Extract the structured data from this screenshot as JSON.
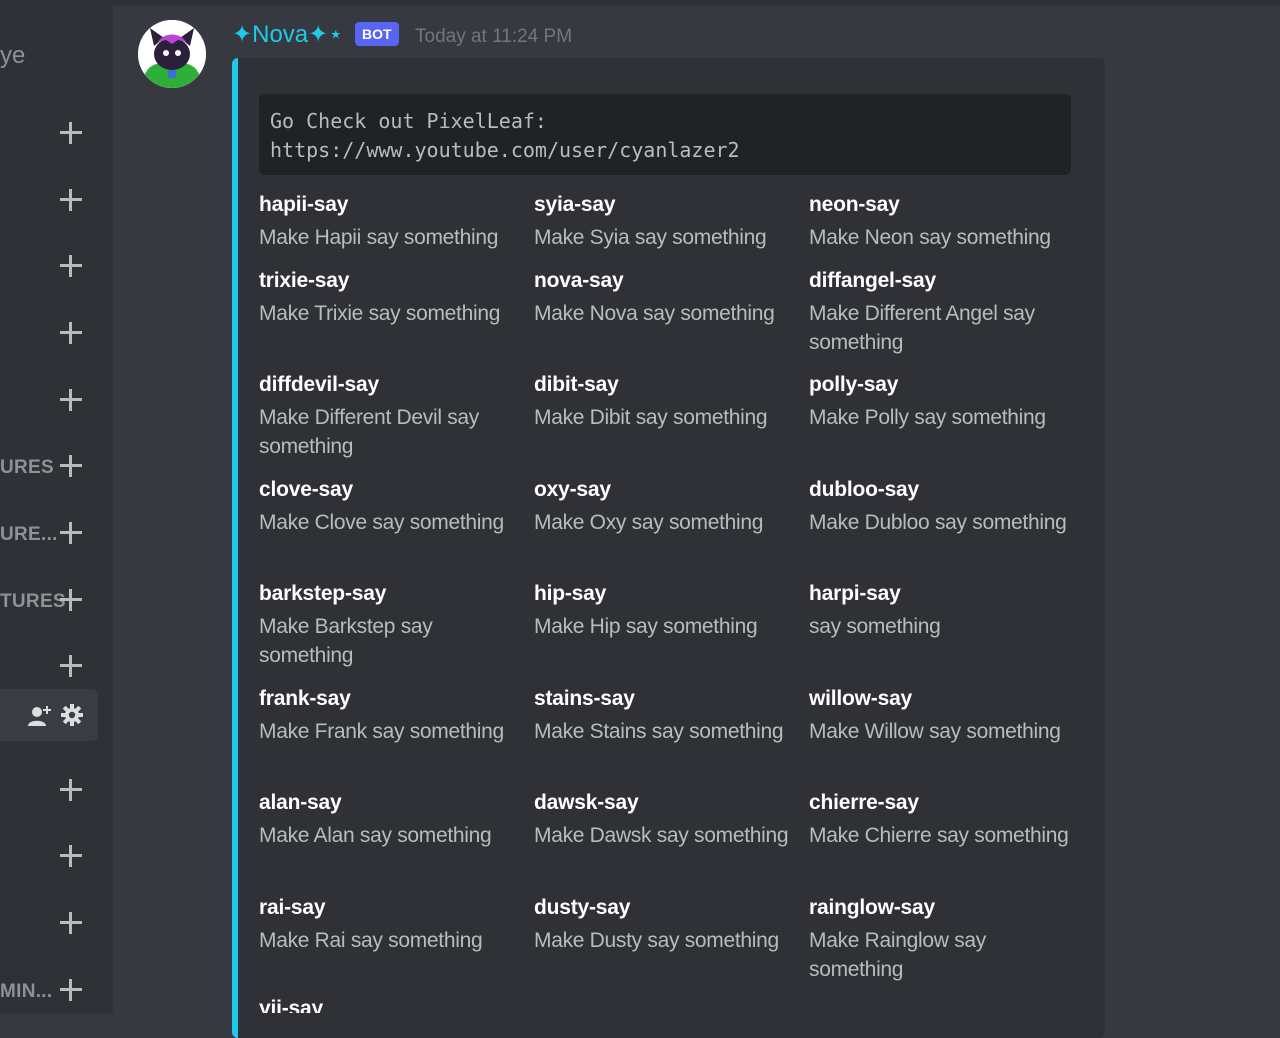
{
  "sidebar": {
    "top_label": "ye",
    "rows": [
      {
        "label": ""
      },
      {
        "label": ""
      },
      {
        "label": ""
      },
      {
        "label": ""
      },
      {
        "label": ""
      },
      {
        "label": "URES"
      },
      {
        "label": "URE..."
      },
      {
        "label": "TURES"
      },
      {
        "label": ""
      },
      {
        "label": ""
      },
      {
        "label": ""
      },
      {
        "label": ""
      },
      {
        "label": "MIN..."
      }
    ]
  },
  "message": {
    "username": "✦Nova✦⋆",
    "bot_tag": "BOT",
    "timestamp": "Today at 11:24 PM",
    "code_lines": [
      "Go Check out PixelLeaf:",
      "https://www.youtube.com/user/cyanlazer2"
    ],
    "fields": [
      {
        "name": "hapii-say",
        "value": "Make Hapii say something"
      },
      {
        "name": "syia-say",
        "value": "Make Syia say something"
      },
      {
        "name": "neon-say",
        "value": "Make Neon say something"
      },
      {
        "name": "trixie-say",
        "value": "Make Trixie say something"
      },
      {
        "name": "nova-say",
        "value": "Make Nova say something"
      },
      {
        "name": "diffangel-say",
        "value": "Make Different Angel say something"
      },
      {
        "name": "diffdevil-say",
        "value": "Make Different Devil say something"
      },
      {
        "name": "dibit-say",
        "value": "Make Dibit say something"
      },
      {
        "name": "polly-say",
        "value": "Make Polly say something"
      },
      {
        "name": "clove-say",
        "value": "Make Clove say something"
      },
      {
        "name": "oxy-say",
        "value": "Make Oxy say something"
      },
      {
        "name": "dubloo-say",
        "value": "Make Dubloo say something"
      },
      {
        "name": "barkstep-say",
        "value": "Make Barkstep say something"
      },
      {
        "name": "hip-say",
        "value": "Make Hip say something"
      },
      {
        "name": "harpi-say",
        "value": "say something"
      },
      {
        "name": "frank-say",
        "value": "Make Frank say something"
      },
      {
        "name": "stains-say",
        "value": "Make Stains say something"
      },
      {
        "name": "willow-say",
        "value": "Make Willow say something"
      },
      {
        "name": "alan-say",
        "value": "Make Alan say something"
      },
      {
        "name": "dawsk-say",
        "value": "Make Dawsk say something"
      },
      {
        "name": "chierre-say",
        "value": "Make Chierre say something"
      },
      {
        "name": "rai-say",
        "value": "Make Rai say something"
      },
      {
        "name": "dusty-say",
        "value": "Make Dusty say something"
      },
      {
        "name": "rainglow-say",
        "value": "Make Rainglow say something"
      },
      {
        "name": "yii-say",
        "value": ""
      }
    ]
  },
  "colors": {
    "accent": "#1ec9ea",
    "bot_tag": "#5865f2",
    "background": "#36393f",
    "embed": "#2f3136"
  },
  "icons": [
    "plus-icon",
    "add-member-icon",
    "gear-icon"
  ]
}
